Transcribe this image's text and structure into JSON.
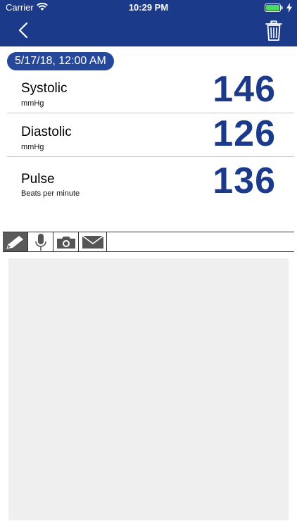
{
  "status_bar": {
    "carrier": "Carrier",
    "time": "10:29 PM",
    "icons": [
      "wifi-icon",
      "battery-icon",
      "charging-bolt-icon"
    ],
    "battery_color": "#4cd964"
  },
  "nav": {
    "back_icon": "chevron-left-icon",
    "delete_icon": "trash-icon",
    "background_color": "#1c3a8a"
  },
  "reading": {
    "date": "5/17/18, 12:00 AM",
    "systolic": {
      "label": "Systolic",
      "unit": "mmHg",
      "value": "146"
    },
    "diastolic": {
      "label": "Diastolic",
      "unit": "mmHg",
      "value": "126"
    },
    "pulse": {
      "label": "Pulse",
      "unit": "Beats per minute",
      "value": "136"
    },
    "value_color": "#1c3a8a"
  },
  "toolbar": {
    "tools": [
      {
        "icon": "pencil-icon",
        "active": true
      },
      {
        "icon": "microphone-icon",
        "active": false
      },
      {
        "icon": "camera-icon",
        "active": false
      },
      {
        "icon": "mail-icon",
        "active": false
      }
    ]
  }
}
